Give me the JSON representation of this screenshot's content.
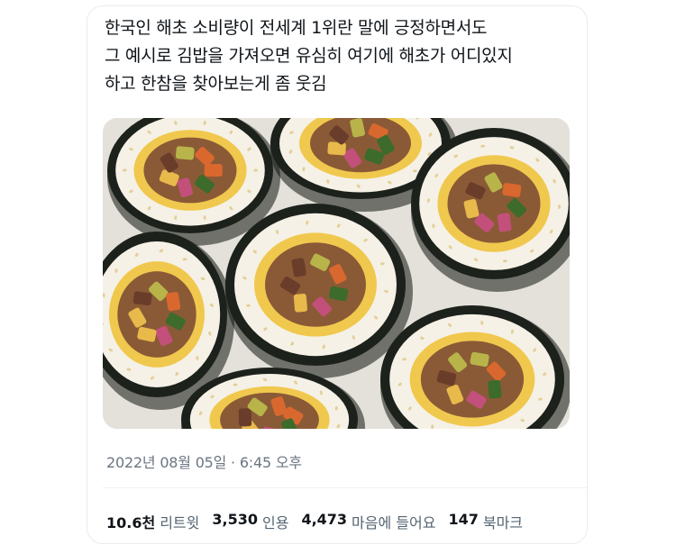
{
  "tweet": {
    "lines": [
      "한국인 해초 소비량이 전세계 1위란 말에 긍정하면서도",
      "그 예시로 김밥을 가져오면 유심히 여기에 해초가 어디있지",
      "하고 한참을 찾아보는게 좀 웃김"
    ],
    "photo_icon": "kimbap-photo",
    "timestamp": "2022년 08월 05일 · 6:45 오후"
  },
  "stats": {
    "retweets": {
      "value": "10.6천",
      "label": "리트윗"
    },
    "quotes": {
      "value": "3,530",
      "label": "인용"
    },
    "likes": {
      "value": "4,473",
      "label": "마음에 들어요"
    },
    "bookmarks": {
      "value": "147",
      "label": "북마크"
    }
  },
  "colors": {
    "text": "#0f1419",
    "muted": "#536471",
    "border": "#e8ebee",
    "nori": "#1c211c",
    "rice": "#f5f1e6"
  }
}
